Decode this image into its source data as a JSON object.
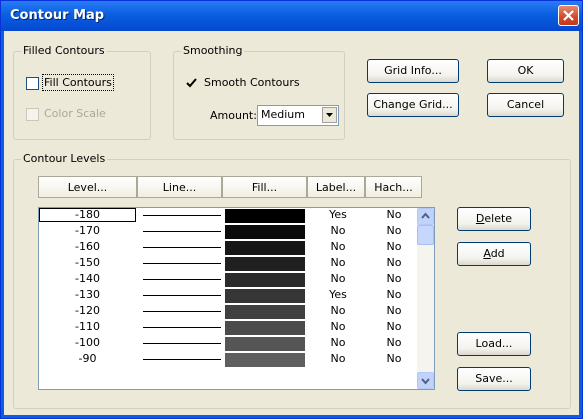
{
  "window": {
    "title": "Contour Map"
  },
  "filled_contours": {
    "group_label": "Filled Contours",
    "fill_contours": {
      "label": "Fill Contours",
      "checked": false
    },
    "color_scale": {
      "label": "Color Scale",
      "checked": false,
      "enabled": false
    }
  },
  "smoothing": {
    "group_label": "Smoothing",
    "smooth_contours": {
      "label": "Smooth Contours",
      "checked": true
    },
    "amount_label": "Amount:",
    "amount_value": "Medium"
  },
  "buttons": {
    "grid_info": "Grid Info...",
    "ok": "OK",
    "change_grid": "Change Grid...",
    "cancel": "Cancel",
    "delete": "Delete",
    "add": "Add",
    "load": "Load...",
    "save": "Save..."
  },
  "contour_levels": {
    "group_label": "Contour Levels",
    "headers": [
      "Level...",
      "Line...",
      "Fill...",
      "Label...",
      "Hach..."
    ],
    "rows": [
      {
        "level": "-180",
        "fill": "#000000",
        "label": "Yes",
        "hach": "No"
      },
      {
        "level": "-170",
        "fill": "#0b0b0b",
        "label": "No",
        "hach": "No"
      },
      {
        "level": "-160",
        "fill": "#161616",
        "label": "No",
        "hach": "No"
      },
      {
        "level": "-150",
        "fill": "#202020",
        "label": "No",
        "hach": "No"
      },
      {
        "level": "-140",
        "fill": "#2b2b2b",
        "label": "No",
        "hach": "No"
      },
      {
        "level": "-130",
        "fill": "#363636",
        "label": "Yes",
        "hach": "No"
      },
      {
        "level": "-120",
        "fill": "#404040",
        "label": "No",
        "hach": "No"
      },
      {
        "level": "-110",
        "fill": "#4b4b4b",
        "label": "No",
        "hach": "No"
      },
      {
        "level": "-100",
        "fill": "#555555",
        "label": "No",
        "hach": "No"
      },
      {
        "level": "-90",
        "fill": "#5f5f5f",
        "label": "No",
        "hach": "No"
      }
    ]
  },
  "colors": {
    "titlebar": "#0a5fe0",
    "dialog_bg": "#ece9d8",
    "close_button": "#d1492a"
  }
}
